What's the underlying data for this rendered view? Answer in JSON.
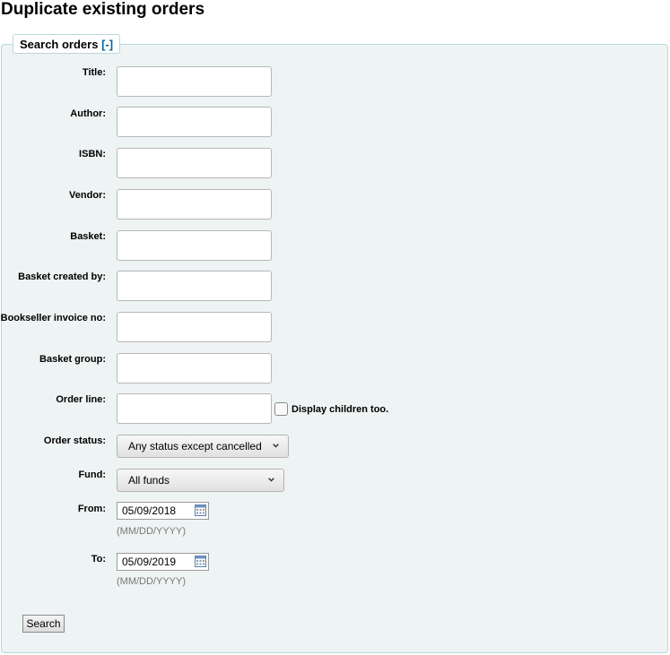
{
  "page": {
    "heading": "Duplicate existing orders"
  },
  "search": {
    "legend": "Search orders",
    "toggle": "[-]",
    "fields": {
      "title": {
        "label": "Title:",
        "value": ""
      },
      "author": {
        "label": "Author:",
        "value": ""
      },
      "isbn": {
        "label": "ISBN:",
        "value": ""
      },
      "vendor": {
        "label": "Vendor:",
        "value": ""
      },
      "basket": {
        "label": "Basket:",
        "value": ""
      },
      "basket_created_by": {
        "label": "Basket created by:",
        "value": ""
      },
      "invoice": {
        "label": "Bookseller invoice no:",
        "value": ""
      },
      "basket_group": {
        "label": "Basket group:",
        "value": ""
      },
      "order_line": {
        "label": "Order line:",
        "value": ""
      }
    },
    "display_children": {
      "label": "Display children too.",
      "checked": false
    },
    "order_status": {
      "label": "Order status:",
      "selected": "Any status except cancelled"
    },
    "fund": {
      "label": "Fund:",
      "selected": "All funds"
    },
    "from": {
      "label": "From:",
      "value": "05/09/2018",
      "hint": "(MM/DD/YYYY)"
    },
    "to": {
      "label": "To:",
      "value": "05/09/2019",
      "hint": "(MM/DD/YYYY)"
    },
    "submit_label": "Search"
  }
}
